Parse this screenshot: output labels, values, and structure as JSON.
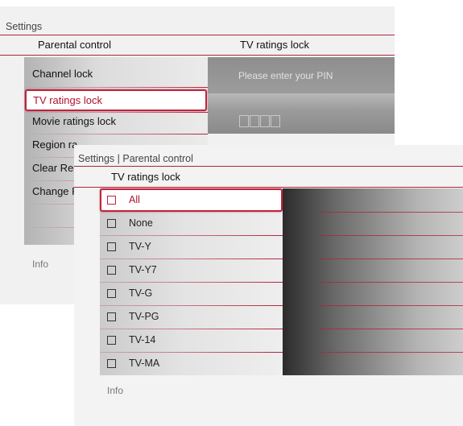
{
  "back_panel": {
    "breadcrumb": "Settings",
    "title_left": "Parental control",
    "title_right": "TV ratings lock",
    "menu_items": [
      {
        "label": "Channel lock",
        "selected": false
      },
      {
        "label": "TV ratings lock",
        "selected": true
      },
      {
        "label": "Movie ratings lock",
        "selected": false
      },
      {
        "label": "Region ra",
        "selected": false
      },
      {
        "label": "Clear Reg",
        "selected": false
      },
      {
        "label": "Change P",
        "selected": false
      }
    ],
    "pin_prompt": "Please enter your PIN",
    "pin_digits": 4,
    "info": "Info"
  },
  "front_panel": {
    "breadcrumb": "Settings | Parental control",
    "title": "TV ratings lock",
    "items": [
      {
        "label": "All",
        "selected": true
      },
      {
        "label": "None",
        "selected": false
      },
      {
        "label": "TV-Y",
        "selected": false
      },
      {
        "label": "TV-Y7",
        "selected": false
      },
      {
        "label": "TV-G",
        "selected": false
      },
      {
        "label": "TV-PG",
        "selected": false
      },
      {
        "label": "TV-14",
        "selected": false
      },
      {
        "label": "TV-MA",
        "selected": false
      }
    ],
    "info": "Info"
  },
  "colors": {
    "accent": "#c4213c",
    "separator": "#b0243a"
  }
}
